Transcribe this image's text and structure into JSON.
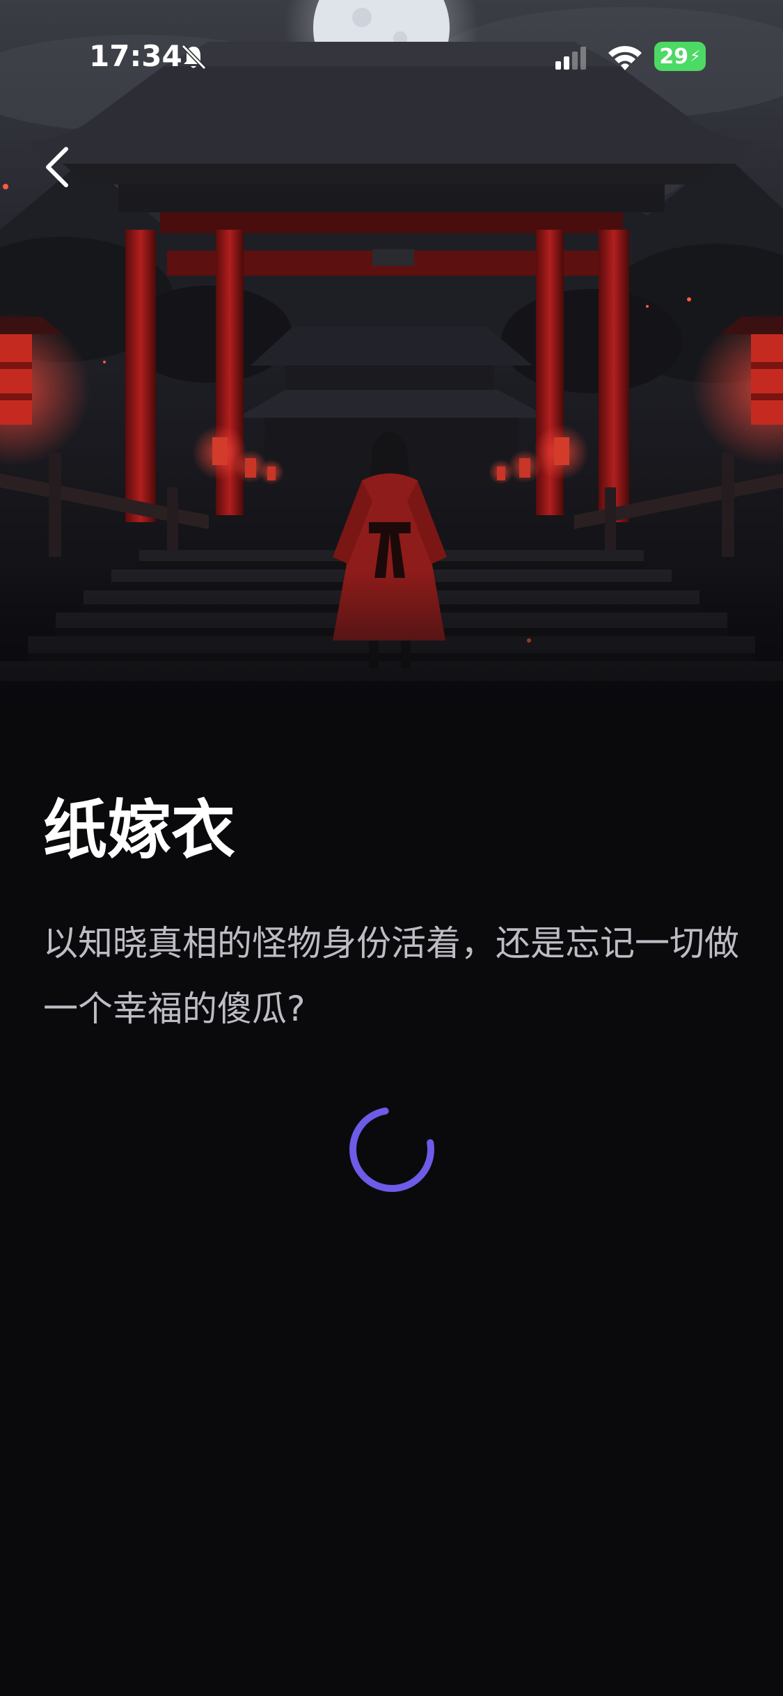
{
  "status_bar": {
    "time": "17:34",
    "battery": "29",
    "icons": {
      "bell": "bell-slash-icon",
      "signal": "cellular-signal-icon",
      "wifi": "wifi-icon",
      "battery": "battery-charging-icon"
    }
  },
  "navigation": {
    "back_icon": "chevron-left-icon"
  },
  "story": {
    "title": "纸嫁衣",
    "description": "以知晓真相的怪物身份活着，还是忘记一切做一个幸福的傻瓜?"
  },
  "loading": {
    "icon": "loading-spinner-icon",
    "accent_color": "#6c5ce7"
  },
  "colors": {
    "background": "#0a0a0d",
    "title": "#ffffff",
    "description": "#bdbdc4",
    "battery": "#4cd964"
  }
}
